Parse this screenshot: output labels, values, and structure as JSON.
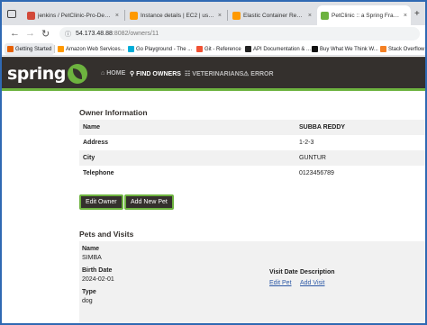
{
  "browser": {
    "tabs": [
      {
        "title": "jenkins / PetClinic-Pro-Dev / #",
        "fav_color": "#d24939",
        "active": false
      },
      {
        "title": "Instance details | EC2 | us-east-",
        "fav_color": "#ff9900",
        "active": false
      },
      {
        "title": "Elastic Container Registry - Ima",
        "fav_color": "#ff9900",
        "active": false
      },
      {
        "title": "PetClinic :: a Spring Framework",
        "fav_color": "#6db33f",
        "active": true
      }
    ],
    "close_glyph": "×",
    "new_tab_glyph": "+",
    "url_host": "54.173.48.88",
    "url_path": ":8082/owners/11",
    "nav_back": "←",
    "nav_forward": "→",
    "nav_reload": "↻"
  },
  "bookmarks": [
    {
      "label": "Getting Started",
      "color": "#e66000"
    },
    {
      "label": "Amazon Web Services...",
      "color": "#ff9900"
    },
    {
      "label": "Go Playground - The ...",
      "color": "#00add8"
    },
    {
      "label": "Git - Reference",
      "color": "#f05133"
    },
    {
      "label": "API Documentation & ...",
      "color": "#222222"
    },
    {
      "label": "Buy What We Think W...",
      "color": "#111111"
    },
    {
      "label": "Stack Overflow",
      "color": "#f48024"
    }
  ],
  "navbar": {
    "logo_text": "spring",
    "items": [
      {
        "icon": "⌂",
        "label": "HOME",
        "active": false
      },
      {
        "icon": "⚲",
        "label": "FIND OWNERS",
        "active": true
      },
      {
        "icon": "☷",
        "label": "VETERINARIANS",
        "active": false
      },
      {
        "icon": "⚠",
        "label": "ERROR",
        "active": false
      }
    ]
  },
  "owner": {
    "section_title": "Owner Information",
    "rows": [
      {
        "label": "Name",
        "value": "SUBBA REDDY"
      },
      {
        "label": "Address",
        "value": "1-2-3"
      },
      {
        "label": "City",
        "value": "GUNTUR"
      },
      {
        "label": "Telephone",
        "value": "0123456789"
      }
    ],
    "edit_button": "Edit Owner",
    "add_pet_button": "Add New Pet"
  },
  "pets": {
    "section_title": "Pets and Visits",
    "name_label": "Name",
    "name_value": "SIMBA",
    "birth_label": "Birth Date",
    "birth_value": "2024-02-01",
    "type_label": "Type",
    "type_value": "dog",
    "visit_date_header": "Visit Date",
    "description_header": "Description",
    "edit_pet_link": "Edit Pet",
    "add_visit_link": "Add Visit"
  },
  "colors": {
    "spring_green": "#6db33f",
    "navbar_bg": "#34302d",
    "window_border": "#2f69b3"
  }
}
